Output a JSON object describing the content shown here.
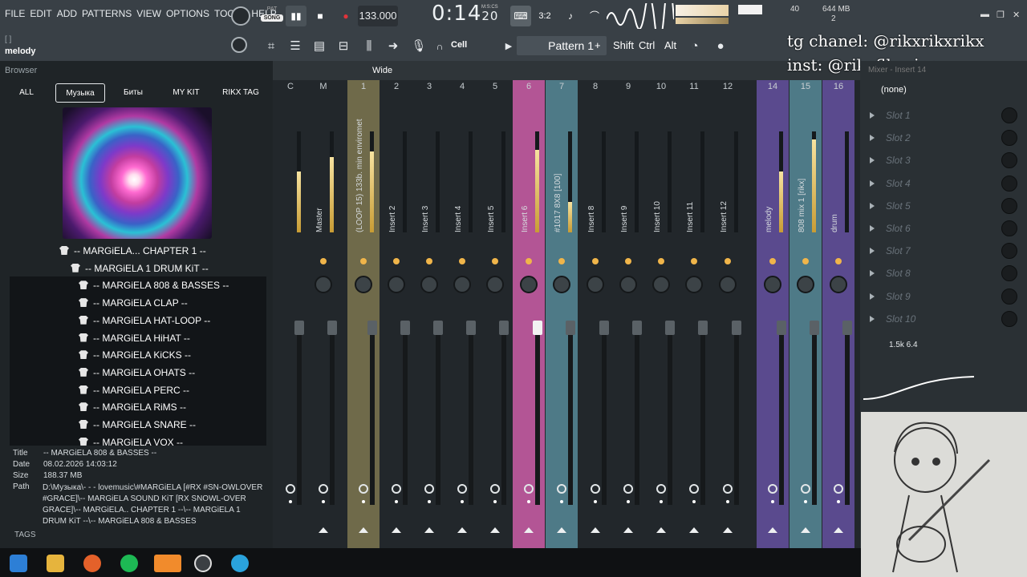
{
  "menu": {
    "items": [
      "FILE",
      "EDIT",
      "ADD",
      "PATTERNS",
      "VIEW",
      "OPTIONS",
      "TOOLS",
      "HELP"
    ]
  },
  "hint": {
    "brackets": "[ ]",
    "target": "melody"
  },
  "transport": {
    "pat_label": "PAT",
    "song_label": "SONG",
    "tempo": "133.000",
    "time": "0:14",
    "time_small": "20",
    "time_format": "M:S:CS",
    "cpu_value": "40",
    "memory": "644 MB",
    "voices": "2"
  },
  "toolbar2": {
    "cell_label": "Cell",
    "pattern_label": "Pattern 1",
    "plus": "+",
    "shift": "Shift",
    "ctrl": "Ctrl",
    "alt": "Alt"
  },
  "overlay": {
    "line1": "tg chanel: @rikxrikxrikx",
    "line2": "inst: @rikxfllxwing"
  },
  "browser": {
    "title": "Browser",
    "tabs": [
      "ALL",
      "Музыка",
      "Биты",
      "MY KIT",
      "RIKX TAG"
    ],
    "tree": [
      "-- MARGiELA... CHAPTER 1 --",
      "-- MARGiELA 1 DRUM KiT --",
      "-- MARGiELA 808 & BASSES --",
      "-- MARGiELA CLAP --",
      "-- MARGiELA HAT-LOOP  --",
      "-- MARGiELA HiHAT  --",
      "-- MARGiELA KiCKS --",
      "-- MARGiELA OHATS --",
      "-- MARGiELA PERC  --",
      "-- MARGiELA RiMS --",
      "-- MARGiELA SNARE --",
      "-- MARGiELA VOX --"
    ],
    "info": {
      "title_key": "Title",
      "title_value": "-- MARGiELA 808 & BASSES --",
      "date_key": "Date",
      "date_value": "08.02.2026 14:03:12",
      "size_key": "Size",
      "size_value": "188.37 MB",
      "path_key": "Path",
      "path_value": "D:\\Музыка\\- - - lovemusic\\#MARGiELA [#RX #SN-OWLOVER #GRACE]\\-- MARGiELA SOUND KiT [RX SNOWL-OVER GRACE]\\-- MARGiELA.. CHAPTER 1 --\\-- MARGiELA 1 DRUM KiT --\\-- MARGiELA 808 & BASSES"
    },
    "tags_label": "TAGS"
  },
  "mixer": {
    "wide_label": "Wide",
    "strips": [
      {
        "num": "C",
        "name": "",
        "level": 0.6
      },
      {
        "num": "M",
        "name": "Master",
        "level": 0.75
      },
      {
        "num": "1",
        "name": "(LOOP 15) 133b. min enviromet",
        "level": 0.8
      },
      {
        "num": "2",
        "name": "Insert 2",
        "level": 0
      },
      {
        "num": "3",
        "name": "Insert 3",
        "level": 0
      },
      {
        "num": "4",
        "name": "Insert 4",
        "level": 0
      },
      {
        "num": "5",
        "name": "Insert 5",
        "level": 0
      },
      {
        "num": "6",
        "name": "Insert 6",
        "level": 0.82
      },
      {
        "num": "7",
        "name": "#1017 8X8 [100]",
        "level": 0.3
      },
      {
        "num": "8",
        "name": "Insert 8",
        "level": 0
      },
      {
        "num": "9",
        "name": "Insert 9",
        "level": 0
      },
      {
        "num": "10",
        "name": "Insert 10",
        "level": 0
      },
      {
        "num": "11",
        "name": "Insert 11",
        "level": 0
      },
      {
        "num": "12",
        "name": "Insert 12",
        "level": 0
      },
      {
        "num": "14",
        "name": "melody",
        "level": 0.6
      },
      {
        "num": "15",
        "name": "808 mix 1 [rikx]",
        "level": 0.92
      },
      {
        "num": "16",
        "name": "drum",
        "level": 0
      }
    ]
  },
  "fx": {
    "title": "Mixer - Insert 14",
    "none": "(none)",
    "slots": [
      "Slot 1",
      "Slot 2",
      "Slot 3",
      "Slot 4",
      "Slot 5",
      "Slot 6",
      "Slot 7",
      "Slot 8",
      "Slot 9",
      "Slot 10"
    ],
    "eq_label": "1.5k 6.4"
  },
  "colors": {
    "accent_gold": "#c8a24a",
    "insert6": "#b35595",
    "insert7": "#4e7a87",
    "purple": "#5a4a8e"
  }
}
